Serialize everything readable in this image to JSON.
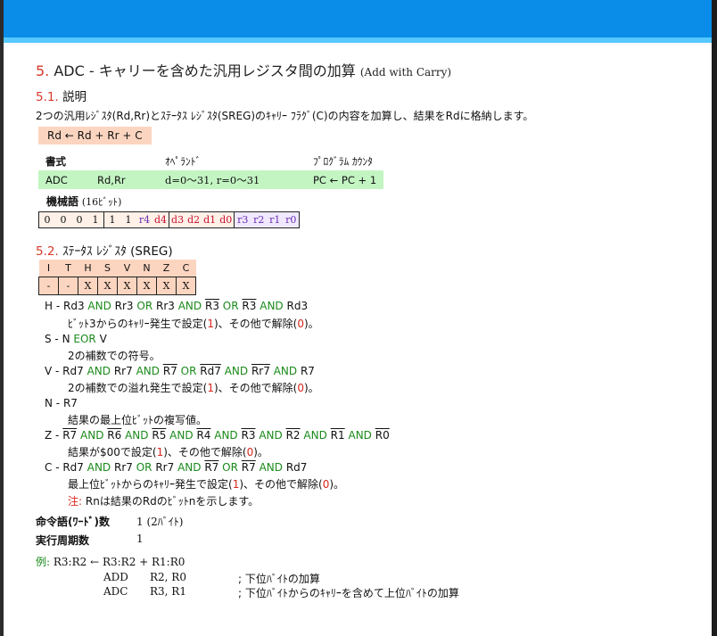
{
  "title": {
    "number": "5.",
    "main": "ADC - キャリーを含めた汎用レジスタ間の加算",
    "english": "(Add with Carry)"
  },
  "section1": {
    "heading_number": "5.1.",
    "heading_text": "説明",
    "description": "2つの汎用ﾚｼﾞｽﾀ(Rd,Rr)とｽﾃｰﾀｽ ﾚｼﾞｽﾀ(SREG)のｷｬﾘｰ ﾌﾗｸﾞ(C)の内容を加算し、結果をRdに格納します。",
    "operation": "Rd ← Rd + Rr + C",
    "syntax": {
      "h_syntax": "書式",
      "h_operands": "ｵﾍﾟﾗﾝﾄﾞ",
      "h_pc": "ﾌﾟﾛｸﾞﾗﾑ ｶｳﾝﾀ",
      "mnemonic": "ADC",
      "args": "Rd,Rr",
      "operands": "d=0～31, r=0～31",
      "pc": "PC ← PC + 1"
    },
    "machine_code_label": "機械語",
    "machine_code_bits": "(16ﾋﾞｯﾄ)",
    "machine_code": [
      "0",
      "0",
      "0",
      "1",
      "1",
      "1",
      "r4",
      "d4",
      "d3",
      "d2",
      "d1",
      "d0",
      "r3",
      "r2",
      "r1",
      "r0"
    ],
    "colors": {
      "red_field": "#c8102e",
      "purple_field": "#6b2fb3",
      "green_op": "#1a8a1a",
      "red_val": "#d8261c"
    }
  },
  "section2": {
    "heading_number": "5.2.",
    "heading_text": "ｽﾃｰﾀｽ ﾚｼﾞｽﾀ (SREG)",
    "flag_names": [
      "I",
      "T",
      "H",
      "S",
      "V",
      "N",
      "Z",
      "C"
    ],
    "flag_values": [
      "-",
      "-",
      "X",
      "X",
      "X",
      "X",
      "X",
      "X"
    ],
    "flags": {
      "h": {
        "key": "H -",
        "desc": "ﾋﾞｯﾄ3からのｷｬﾘｰ発生で設定(1)、その他で解除(0)。"
      },
      "s": {
        "key": "S -",
        "desc": "2の補数での符号。"
      },
      "v": {
        "key": "V -",
        "desc": "2の補数での溢れ発生で設定(1)、その他で解除(0)。"
      },
      "n": {
        "key": "N -",
        "desc": "結果の最上位ﾋﾞｯﾄの複写値。"
      },
      "z": {
        "key": "Z -",
        "desc": "結果が$00で設定(1)、その他で解除(0)。"
      },
      "c": {
        "key": "C -",
        "desc": "最上位ﾋﾞｯﾄからのｷｬﾘｰ発生で設定(1)、その他で解除(0)。"
      }
    },
    "note_label": "注:",
    "note_text": "Rnは結果のRdのﾋﾞｯﾄnを示します。"
  },
  "words": {
    "label": "命令語(ﾜｰﾄﾞ)数",
    "value": "1 (2ﾊﾞｲﾄ)"
  },
  "cycles": {
    "label": "実行周期数",
    "value": "1"
  },
  "example": {
    "label": "例:",
    "expr": "R3:R2 ← R3:R2 + R1:R0",
    "lines": [
      {
        "mnemonic": "ADD",
        "args": "R2, R0",
        "comment": "; 下位ﾊﾞｲﾄの加算"
      },
      {
        "mnemonic": "ADC",
        "args": "R3, R1",
        "comment": "; 下位ﾊﾞｲﾄからのｷｬﾘｰを含めて上位ﾊﾞｲﾄの加算"
      }
    ]
  }
}
